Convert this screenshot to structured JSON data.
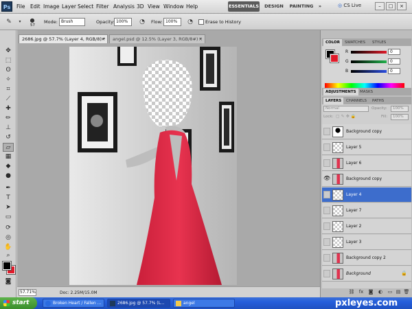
{
  "app": {
    "logo": "Ps"
  },
  "menubar": {
    "items": [
      "File",
      "Edit",
      "Image",
      "Layer",
      "Select",
      "Filter",
      "Analysis",
      "3D",
      "View",
      "Window",
      "Help"
    ],
    "zoom": "57.7",
    "workspaces": {
      "essentials": "ESSENTIALS",
      "design": "DESIGN",
      "painting": "PAINTING",
      "more": "»"
    },
    "cs_live": "CS Live"
  },
  "options": {
    "brush_size": "57",
    "mode_label": "Mode:",
    "mode_value": "Brush",
    "opacity_label": "Opacity:",
    "opacity_value": "100%",
    "flow_label": "Flow:",
    "flow_value": "100%",
    "erase_history_label": "Erase to History"
  },
  "documents": {
    "tabs": [
      {
        "label": "2686.jpg @ 57.7% (Layer 4, RGB/8) *",
        "active": true
      },
      {
        "label": "angel.psd @ 12.5% (Layer 3, RGB/8#) *",
        "active": false
      }
    ],
    "status_zoom": "57.71%",
    "status_doc": "Doc: 2.25M/15.0M"
  },
  "color_panel": {
    "tabs": [
      "COLOR",
      "SWATCHES",
      "STYLES"
    ],
    "channels": [
      {
        "label": "R",
        "value": "0",
        "color": "#e01b2a"
      },
      {
        "label": "G",
        "value": "0",
        "color": "#22b14c"
      },
      {
        "label": "B",
        "value": "0",
        "color": "#2a4de0"
      }
    ]
  },
  "adjust_tabs": [
    "ADJUSTMENTS",
    "MASKS"
  ],
  "layers_panel": {
    "tabs": [
      "LAYERS",
      "CHANNELS",
      "PATHS"
    ],
    "blend_mode": "Normal",
    "opacity_label": "Opacity:",
    "opacity_value": "100%",
    "lock_label": "Lock:",
    "fill_label": "Fill:",
    "fill_value": "100%",
    "layers": [
      {
        "name": "Background copy",
        "visible": false,
        "selected": false,
        "thumb": "mask"
      },
      {
        "name": "Layer 5",
        "visible": false,
        "selected": false,
        "thumb": "transparent"
      },
      {
        "name": "Layer 6",
        "visible": false,
        "selected": false,
        "thumb": "figure"
      },
      {
        "name": "Background copy",
        "visible": true,
        "selected": false,
        "thumb": "figure"
      },
      {
        "name": "Layer 4",
        "visible": false,
        "selected": true,
        "thumb": "transparent"
      },
      {
        "name": "Layer 7",
        "visible": false,
        "selected": false,
        "thumb": "transparent"
      },
      {
        "name": "Layer 2",
        "visible": false,
        "selected": false,
        "thumb": "transparent"
      },
      {
        "name": "Layer 3",
        "visible": false,
        "selected": false,
        "thumb": "transparent"
      },
      {
        "name": "Background copy 2",
        "visible": false,
        "selected": false,
        "thumb": "figure"
      },
      {
        "name": "Background",
        "visible": false,
        "selected": false,
        "thumb": "figure",
        "italic": true,
        "locked": true
      }
    ]
  },
  "taskbar": {
    "start": "start",
    "items": [
      {
        "label": "Broken Heart / Fallen ...",
        "active": false
      },
      {
        "label": "2686.jpg @ 57.7% (L...",
        "active": true
      },
      {
        "label": "angel",
        "active": false
      }
    ],
    "watermark": "pxleyes.com"
  }
}
